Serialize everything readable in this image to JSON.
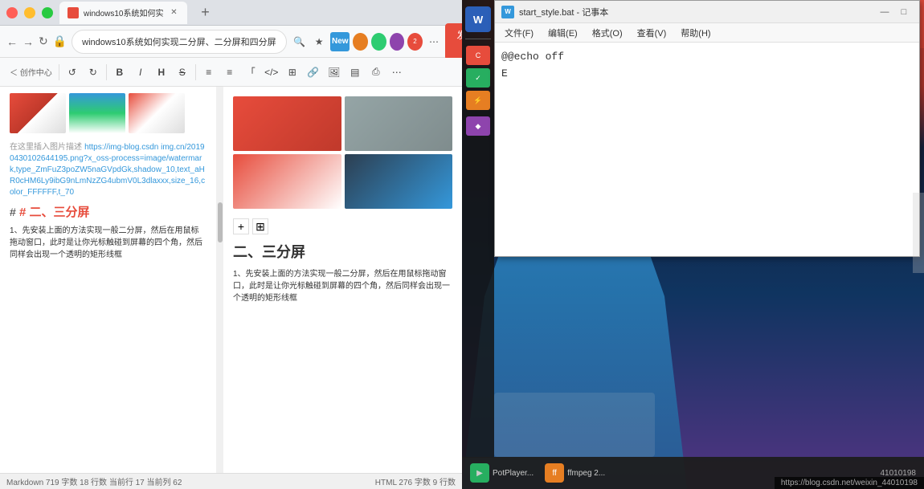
{
  "browser": {
    "title": "windows10系统如何实现二分屏、二分屏和四分屏",
    "tab_label": "windows10系统如何实",
    "address_bar_text": "windows10系统如何实现二分屏、二分屏和四分屏",
    "publish_btn": "发布文章",
    "editor_tools": [
      "←",
      "→",
      "B",
      "I",
      "H",
      "S",
      "≡",
      "≡",
      "「",
      "</>",
      "⊞",
      "🔗",
      "🖼",
      "▤",
      "⎙",
      "⋯"
    ],
    "new_tab_icon": "+",
    "section_title": "二、三分屏",
    "section_subtitle": "# 二、三分屏",
    "section_content": "1、先安装上面的方法实现一般二分屏，然后在用鼠标拖动窗口，此时是让你光标触碰到屏幕的四个角，然后同样会出现一个透明的矩形线框",
    "right_content": "1、先安装上面的方法实现一般二分屏，然后在用鼠标拖动窗口，此时是让你光标触碰到屏幕的四个角，然后同样会出现一个透明的矩形线框",
    "status_bar": "Markdown 719 字数 18 行数 当前行 17 当前列 62",
    "status_bar_right": "HTML 276 字数 9 行数"
  },
  "notepad": {
    "title": "start_style.bat - 记事本",
    "title_icon": "W",
    "menu_items": [
      "文件(F)",
      "编辑(E)",
      "格式(O)",
      "查看(V)",
      "帮助(H)"
    ],
    "content_line1": "@echo off",
    "content_line2": "E",
    "minimize_btn": "—",
    "maximize_btn": "□",
    "close_btn": "✕"
  },
  "taskbar": {
    "potplayer_label": "PotPlayer...",
    "ffmpeg_label": "ffmpeg 2...",
    "url_bottom": "https://blog.csdn.net/weixin_44010198"
  },
  "desktop": {
    "wallpaper_desc": "fantasy game wallpaper with fire and character"
  }
}
